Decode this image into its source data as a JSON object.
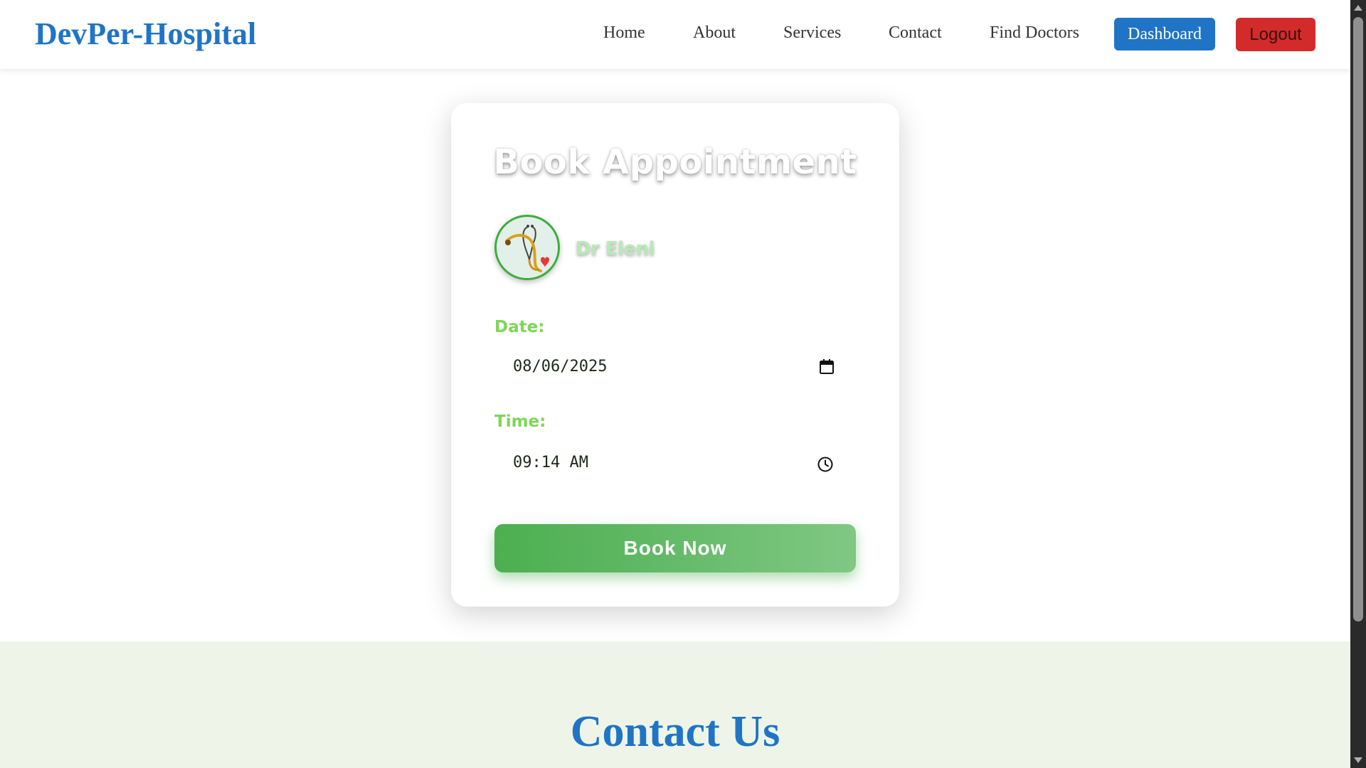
{
  "navbar": {
    "brand": "DevPer-Hospital",
    "links": [
      "Home",
      "About",
      "Services",
      "Contact",
      "Find Doctors"
    ],
    "dashboard_label": "Dashboard",
    "logout_label": "Logout"
  },
  "booking": {
    "title": "Book Appointment",
    "doctor_name": "Dr Eleni",
    "doctor_icon": "stethoscope-heart-icon",
    "date_label": "Date:",
    "date_value": "08/06/2025",
    "date_icon": "calendar-icon",
    "time_label": "Time:",
    "time_value": "09:14 AM",
    "time_icon": "clock-icon",
    "submit_label": "Book Now"
  },
  "contact": {
    "title": "Contact Us"
  },
  "colors": {
    "brand_blue": "#1f74c6",
    "logout_red": "#d32b2b",
    "accent_green": "#4caf50",
    "label_green": "#7ed657",
    "contact_bg": "#eef5e8"
  }
}
